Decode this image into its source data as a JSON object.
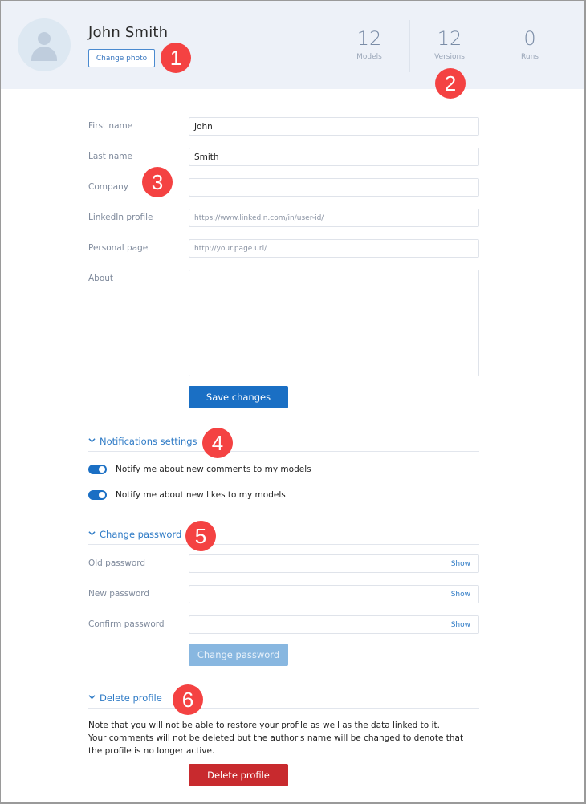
{
  "header": {
    "user_name": "John Smith",
    "change_photo_label": "Change photo",
    "stats": [
      {
        "value": "12",
        "label": "Models"
      },
      {
        "value": "12",
        "label": "Versions"
      },
      {
        "value": "0",
        "label": "Runs"
      }
    ]
  },
  "badges": [
    "1",
    "2",
    "3",
    "4",
    "5",
    "6"
  ],
  "profile_form": {
    "first_name": {
      "label": "First name",
      "value": "John"
    },
    "last_name": {
      "label": "Last name",
      "value": "Smith"
    },
    "company": {
      "label": "Company",
      "value": ""
    },
    "linkedin": {
      "label": "LinkedIn profile",
      "placeholder": "https://www.linkedin.com/in/user-id/"
    },
    "personal_page": {
      "label": "Personal page",
      "placeholder": "http://your.page.url/"
    },
    "about": {
      "label": "About",
      "value": ""
    },
    "save_label": "Save changes"
  },
  "notifications": {
    "title": "Notifications settings",
    "items": [
      {
        "label": "Notify me about new comments to my models",
        "enabled": true
      },
      {
        "label": "Notify me about new likes to my models",
        "enabled": true
      }
    ]
  },
  "password": {
    "title": "Change password",
    "fields": [
      {
        "label": "Old password",
        "show_label": "Show"
      },
      {
        "label": "New password",
        "show_label": "Show"
      },
      {
        "label": "Confirm password",
        "show_label": "Show"
      }
    ],
    "submit_label": "Change password"
  },
  "delete_profile": {
    "title": "Delete profile",
    "note_line1": "Note that you will not be able to restore your profile as well as the data linked to it.",
    "note_line2": "Your comments will not be deleted but the author's name will be changed to denote that the profile is no longer active.",
    "button_label": "Delete profile"
  },
  "colors": {
    "accent": "#1a6fc4",
    "danger": "#c82a2e",
    "badge": "#f44242",
    "header_bg": "#edf1f8"
  }
}
